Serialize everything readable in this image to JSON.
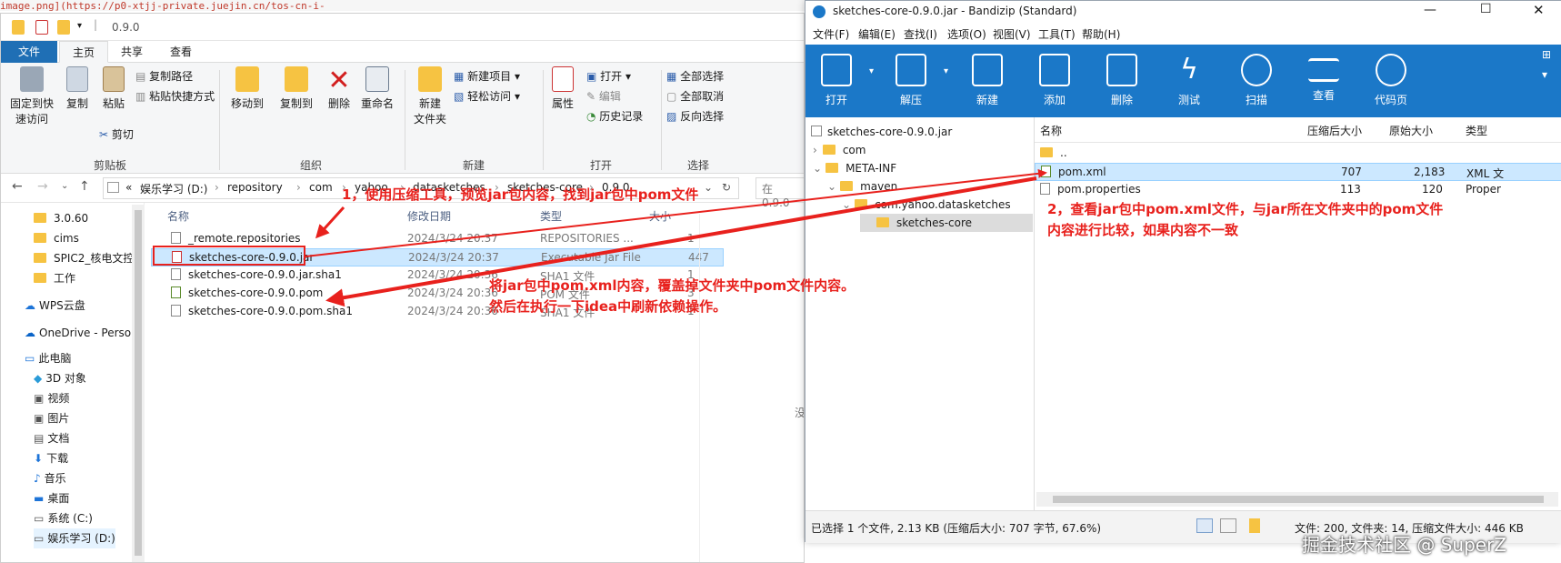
{
  "background": {
    "code_line": "image.png](https://p0-xtjj-private.juejin.cn/tos-cn-i-"
  },
  "explorer": {
    "title": "0.9.0",
    "tabs": {
      "file": "文件",
      "home": "主页",
      "share": "共享",
      "view": "查看"
    },
    "ribbon": {
      "pin_quick": "固定到快速访问",
      "pin_quick_1": "固定到快",
      "pin_quick_2": "速访问",
      "copy": "复制",
      "paste": "粘贴",
      "copy_path": "复制路径",
      "paste_shortcut": "粘贴快捷方式",
      "cut": "剪切",
      "group_clipboard": "剪贴板",
      "move_to": "移动到",
      "copy_to": "复制到",
      "delete": "删除",
      "rename": "重命名",
      "group_organize": "组织",
      "new_folder_1": "新建",
      "new_folder_2": "文件夹",
      "new_item": "新建项目",
      "easy_access": "轻松访问",
      "group_new": "新建",
      "properties": "属性",
      "open": "打开",
      "edit": "编辑",
      "history": "历史记录",
      "group_open": "打开",
      "select_all": "全部选择",
      "select_none": "全部取消",
      "invert": "反向选择",
      "group_select": "选择"
    },
    "address": {
      "prefix": "«",
      "crumbs": [
        "娱乐学习 (D:)",
        "repository",
        "com",
        "yahoo",
        "datasketches",
        "sketches-core",
        "0.9.0"
      ],
      "search_placeholder": "在 0.9.0"
    },
    "nav": [
      "3.0.60",
      "cims",
      "SPIC2_核电文控",
      "工作",
      "WPS云盘",
      "OneDrive - Perso",
      "此电脑",
      "3D 对象",
      "视频",
      "图片",
      "文档",
      "下载",
      "音乐",
      "桌面",
      "系统 (C:)",
      "娱乐学习 (D:)"
    ],
    "columns": {
      "name": "名称",
      "date": "修改日期",
      "type": "类型",
      "size": "大小"
    },
    "files": [
      {
        "name": "_remote.repositories",
        "date": "2024/3/24 20:37",
        "type": "REPOSITORIES ...",
        "size": "1"
      },
      {
        "name": "sketches-core-0.9.0.jar",
        "date": "2024/3/24 20:37",
        "type": "Executable Jar File",
        "size": "447"
      },
      {
        "name": "sketches-core-0.9.0.jar.sha1",
        "date": "2024/3/24 20:36",
        "type": "SHA1 文件",
        "size": "1"
      },
      {
        "name": "sketches-core-0.9.0.pom",
        "date": "2024/3/24 20:36",
        "type": "POM 文件",
        "size": "3"
      },
      {
        "name": "sketches-core-0.9.0.pom.sha1",
        "date": "2024/3/24 20:36",
        "type": "SHA1 文件",
        "size": "1"
      }
    ],
    "empty_hint": "没"
  },
  "bandizip": {
    "title": "sketches-core-0.9.0.jar - Bandizip (Standard)",
    "menu": [
      "文件(F)",
      "编辑(E)",
      "查找(I)",
      "选项(O)",
      "视图(V)",
      "工具(T)",
      "帮助(H)"
    ],
    "toolbar": [
      "打开",
      "解压",
      "新建",
      "添加",
      "删除",
      "测试",
      "扫描",
      "查看",
      "代码页"
    ],
    "tree": {
      "root": "sketches-core-0.9.0.jar",
      "com": "com",
      "meta_inf": "META-INF",
      "maven": "maven",
      "group": "com.yahoo.datasketches",
      "artifact": "sketches-core"
    },
    "columns": {
      "name": "名称",
      "compressed": "压缩后大小",
      "original": "原始大小",
      "type": "类型"
    },
    "rows": [
      {
        "name": "..",
        "compressed": "",
        "original": "",
        "type": ""
      },
      {
        "name": "pom.xml",
        "compressed": "707",
        "original": "2,183",
        "type": "XML 文"
      },
      {
        "name": "pom.properties",
        "compressed": "113",
        "original": "120",
        "type": "Proper"
      }
    ],
    "status_left": "已选择 1 个文件, 2.13 KB (压缩后大小: 707 字节, 67.6%)",
    "status_right": "文件: 200, 文件夹: 14, 压缩文件大小: 446 KB"
  },
  "annotations": {
    "step1": "1，使用压缩工具，预览jar包内容，找到jar包中pom文件",
    "step2_line1": "2，查看jar包中pom.xml文件，与jar所在文件夹中的pom文件",
    "step2_line2": "内容进行比较，如果内容不一致",
    "step3_line1": "将jar包中pom.xml内容，覆盖掉文件夹中pom文件内容。",
    "step3_line2": "然后在执行一下idea中刷新依赖操作。",
    "accent": "#e8211d"
  },
  "watermark": "掘金技术社区 @ SuperZ"
}
